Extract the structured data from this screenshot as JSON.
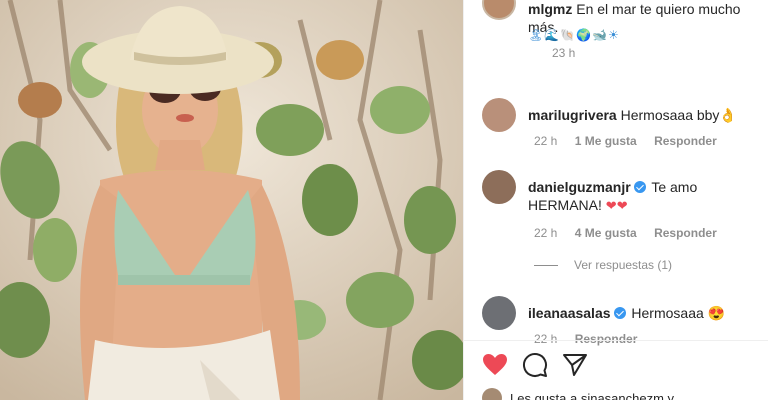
{
  "post": {
    "author": "mlgmz",
    "caption": "En el mar te quiero mucho más.",
    "caption_emoji": "🏝🌊🐚🌍🐋☀",
    "time": "23 h"
  },
  "comments": [
    {
      "user": "marilugrivera",
      "text": "Hermosaaa bby👌",
      "time": "22 h",
      "likes": "1 Me gusta",
      "reply": "Responder"
    },
    {
      "user": "danielguzmanjr",
      "verified": true,
      "text": "Te amo HERMANA!",
      "hearts": "❤❤",
      "time": "22 h",
      "likes": "4 Me gusta",
      "reply": "Responder",
      "view_replies": "Ver respuestas (1)"
    },
    {
      "user": "ileanaasalas",
      "verified": true,
      "text": "Hermosaaa 😍",
      "time": "22 h",
      "likes": "",
      "reply": "Responder"
    }
  ],
  "footer": {
    "likes_text": "Les gusta a sinasanchezm y"
  },
  "icons": [
    "heart-icon",
    "comment-icon",
    "share-icon"
  ],
  "colors": {
    "liked": "#ed4956",
    "verified": "#3897f0",
    "muted": "#8e8e8e"
  }
}
